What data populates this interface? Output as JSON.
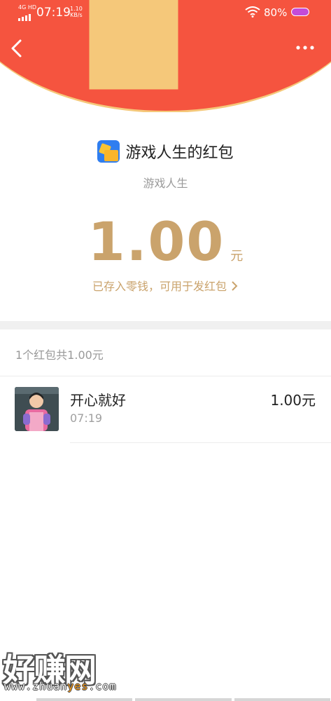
{
  "status_bar": {
    "network": "4G HD",
    "time": "07:19",
    "speed_value": "1.10",
    "speed_unit": "KB/s",
    "battery": "80%"
  },
  "sender": {
    "name": "游戏人生的红包",
    "subtitle": "游戏人生",
    "icon": "puzzle-app-icon"
  },
  "amount": {
    "value": "1.00",
    "unit": "元",
    "note": "已存入零钱，可用于发红包",
    "note_icon": "chevron-right-icon"
  },
  "summary": "1个红包共1.00元",
  "records": [
    {
      "name": "开心就好",
      "time": "07:19",
      "amount": "1.00元"
    }
  ],
  "watermark": {
    "text": "好赚网",
    "url_prefix": "www.zhuan",
    "url_highlight": "yes",
    "url_suffix": ".com"
  },
  "colors": {
    "header_red": "#f5543f",
    "gold": "#caa36c"
  }
}
